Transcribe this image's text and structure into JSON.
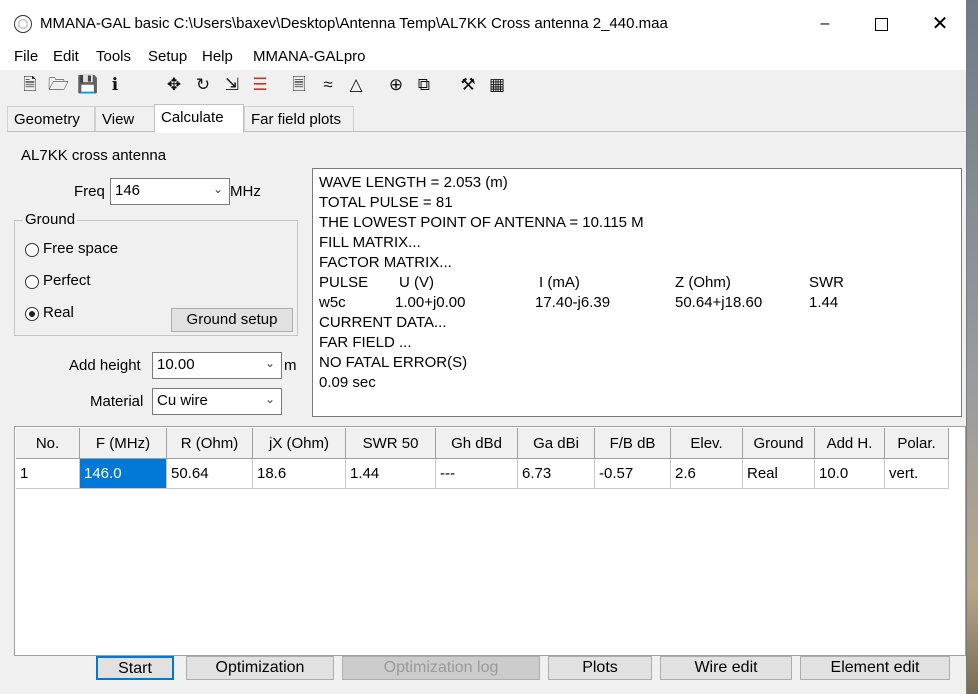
{
  "window": {
    "title": "MMANA-GAL basic C:\\Users\\baxev\\Desktop\\Antenna Temp\\AL7KK Cross antenna 2_440.maa",
    "controls": {
      "minimize": "–",
      "close": "✕"
    }
  },
  "menu": [
    "File",
    "Edit",
    "Tools",
    "Setup",
    "Help",
    "MMANA-GALpro"
  ],
  "toolbar_icons": [
    "new-file-icon",
    "open-folder-icon",
    "save-icon",
    "info-icon",
    "move-icon",
    "rotate-icon",
    "stretch-icon",
    "ladder-icon",
    "document-icon",
    "compare-icon",
    "triangle-icon",
    "target-icon",
    "copy-icon",
    "tools-icon",
    "calculator-icon"
  ],
  "tabs": [
    "Geometry",
    "View",
    "Calculate",
    "Far field plots"
  ],
  "active_tab": "Calculate",
  "calc": {
    "antenna_name": "AL7KK cross antenna",
    "freq_label": "Freq",
    "freq_value": "146",
    "freq_unit": "MHz",
    "ground_legend": "Ground",
    "ground_options": [
      "Free space",
      "Perfect",
      "Real"
    ],
    "ground_selected": "Real",
    "ground_setup_button": "Ground setup",
    "add_height_label": "Add height",
    "add_height_value": "10.00",
    "add_height_unit": "m",
    "material_label": "Material",
    "material_value": "Cu wire"
  },
  "output_lines": [
    "WAVE LENGTH = 2.053 (m)",
    "TOTAL PULSE = 81",
    "THE LOWEST POINT OF ANTENNA = 10.115 M",
    "FILL MATRIX...",
    "FACTOR MATRIX...",
    "PULSE",
    "w5c",
    "CURRENT DATA...",
    "FAR FIELD ...",
    "NO FATAL ERROR(S)",
    "0.09 sec"
  ],
  "pulse_table": {
    "headers": [
      "U (V)",
      "I (mA)",
      "Z (Ohm)",
      "SWR"
    ],
    "values": [
      "1.00+j0.00",
      "17.40-j6.39",
      "50.64+j18.60",
      "1.44"
    ]
  },
  "results_table": {
    "headers": [
      "No.",
      "F (MHz)",
      "R (Ohm)",
      "jX (Ohm)",
      "SWR 50",
      "Gh dBd",
      "Ga dBi",
      "F/B dB",
      "Elev.",
      "Ground",
      "Add H.",
      "Polar."
    ],
    "rows": [
      [
        "1",
        "146.0",
        "50.64",
        "18.6",
        "1.44",
        "---",
        "6.73",
        "-0.57",
        "2.6",
        "Real",
        "10.0",
        "vert."
      ]
    ]
  },
  "bottom_buttons": [
    "Start",
    "Optimization",
    "Optimization log",
    "Plots",
    "Wire edit",
    "Element edit"
  ]
}
